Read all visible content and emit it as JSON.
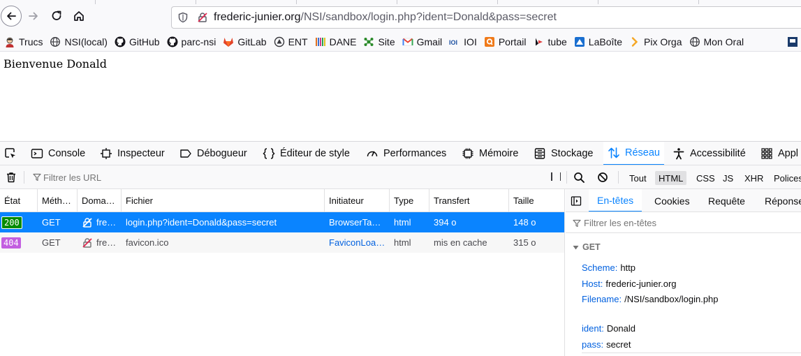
{
  "urlbar": {
    "host": "frederic-junier.org",
    "path": "/NSI/sandbox/login.php?ident=Donald&pass=secret"
  },
  "bookmarks": [
    {
      "label": "Trucs",
      "icon": "person-avatar-icon"
    },
    {
      "label": "NSI(local)",
      "icon": "globe-icon"
    },
    {
      "label": "GitHub",
      "icon": "github-icon"
    },
    {
      "label": "parc-nsi",
      "icon": "github-icon"
    },
    {
      "label": "GitLab",
      "icon": "gitlab-icon"
    },
    {
      "label": "ENT",
      "icon": "ent-icon"
    },
    {
      "label": "DANE",
      "icon": "dane-icon"
    },
    {
      "label": "Site",
      "icon": "site-icon"
    },
    {
      "label": "Gmail",
      "icon": "gmail-icon"
    },
    {
      "label": "IOI",
      "icon": "ioi-icon"
    },
    {
      "label": "Portail",
      "icon": "portail-icon"
    },
    {
      "label": "tube",
      "icon": "tube-icon"
    },
    {
      "label": "LaBoîte",
      "icon": "laboite-icon"
    },
    {
      "label": "Pix Orga",
      "icon": "pix-icon"
    },
    {
      "label": "Mon Oral",
      "icon": "globe-icon"
    }
  ],
  "page": {
    "welcome": "Bienvenue Donald"
  },
  "devtools": {
    "tabs": [
      {
        "label": "Console",
        "icon": "console-icon"
      },
      {
        "label": "Inspecteur",
        "icon": "inspector-icon"
      },
      {
        "label": "Débogueur",
        "icon": "debugger-icon"
      },
      {
        "label": "Éditeur de style",
        "icon": "style-editor-icon"
      },
      {
        "label": "Performances",
        "icon": "performance-icon"
      },
      {
        "label": "Mémoire",
        "icon": "memory-icon"
      },
      {
        "label": "Stockage",
        "icon": "storage-icon"
      },
      {
        "label": "Réseau",
        "icon": "network-icon"
      },
      {
        "label": "Accessibilité",
        "icon": "accessibility-icon"
      },
      {
        "label": "Appl",
        "icon": "application-icon"
      }
    ],
    "active_tab": "Réseau",
    "filter_placeholder": "Filtrer les URL",
    "type_filters": [
      "Tout",
      "HTML",
      "CSS",
      "JS",
      "XHR",
      "Polices"
    ],
    "active_filter": "HTML"
  },
  "requests": {
    "columns": [
      "État",
      "Méth…",
      "Doma…",
      "Fichier",
      "Initiateur",
      "Type",
      "Transfert",
      "Taille"
    ],
    "rows": [
      {
        "status": "200",
        "status_color": "#058b00",
        "method": "GET",
        "domain": "fre…",
        "file": "login.php?ident=Donald&pass=secret",
        "initiator": "BrowserTa…",
        "type": "html",
        "transfer": "394 o",
        "size": "148 o"
      },
      {
        "status": "404",
        "status_color": "#c35fe0",
        "method": "GET",
        "domain": "fre…",
        "file": "favicon.ico",
        "initiator": "FaviconLoa…",
        "type": "html",
        "transfer": "mis en cache",
        "size": "315 o"
      }
    ]
  },
  "side_panel": {
    "tabs": [
      "En-têtes",
      "Cookies",
      "Requête",
      "Réponse"
    ],
    "active_tab": "En-têtes",
    "filter_placeholder": "Filtrer les en-têtes",
    "get_title": "GET",
    "fields": [
      {
        "key": "Scheme:",
        "value": "http"
      },
      {
        "key": "Host:",
        "value": "frederic-junier.org"
      },
      {
        "key": "Filename:",
        "value": "/NSI/sandbox/login.php"
      }
    ],
    "params": [
      {
        "key": "ident:",
        "value": "Donald"
      },
      {
        "key": "pass:",
        "value": "secret"
      }
    ]
  },
  "colors": {
    "accent": "#0a84ff",
    "status_ok": "#058b00",
    "status_404": "#c35fe0",
    "key_blue": "#0060df"
  }
}
